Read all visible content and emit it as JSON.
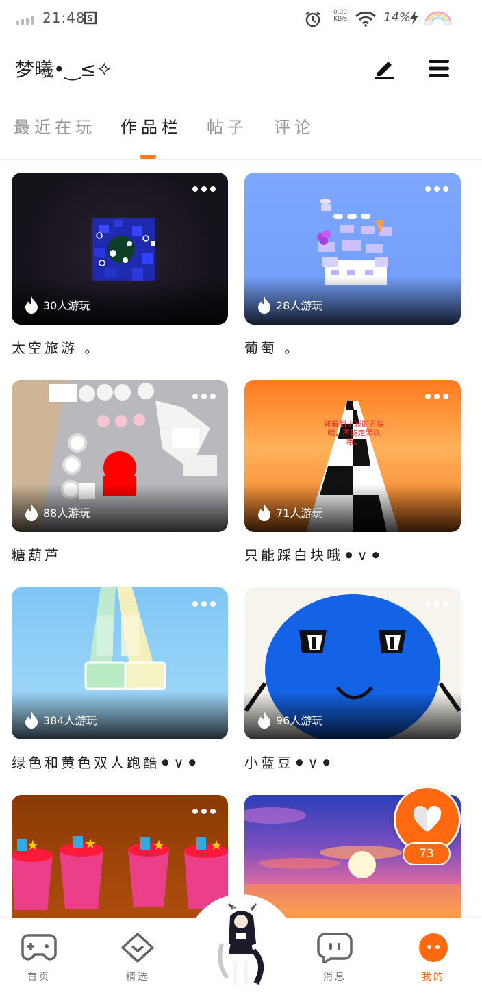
{
  "status_bar": {
    "time": "21:48",
    "net_speed_value": "0.00",
    "net_speed_unit": "KB/s",
    "battery": "14%",
    "icons": [
      "signal-icon",
      "screen-capture-icon",
      "alarm-icon",
      "wifi-icon",
      "charging-icon",
      "rainbow-icon"
    ]
  },
  "header": {
    "username": "梦曦•‿≤✧"
  },
  "tabs": [
    {
      "label": "最近在玩",
      "active": false
    },
    {
      "label": "作品栏",
      "active": true
    },
    {
      "label": "帖子",
      "active": false
    },
    {
      "label": "评论",
      "active": false
    }
  ],
  "works": [
    {
      "title": "太空旅游 。",
      "plays": "30人游玩"
    },
    {
      "title": "葡萄 。",
      "plays": "28人游玩"
    },
    {
      "title": "糖葫芦",
      "plays": "88人游玩"
    },
    {
      "title": "只能踩白块哦⚫∨⚫",
      "plays": "71人游玩"
    },
    {
      "title": "绿色和黄色双人跑酷⚫∨⚫",
      "plays": "384人游玩"
    },
    {
      "title": "小蓝豆⚫∨⚫",
      "plays": "96人游玩"
    },
    {
      "title": "",
      "plays": ""
    },
    {
      "title": "",
      "plays": ""
    }
  ],
  "piano_overlay_text": "按着到止端的方块哦，不能走黑块哦。",
  "like": {
    "count": "73"
  },
  "bottom_nav": [
    {
      "label": "首页",
      "icon": "gamepad-icon",
      "active": false
    },
    {
      "label": "精选",
      "icon": "heart-badge-icon",
      "active": false
    },
    {
      "label": "消息",
      "icon": "chat-icon",
      "active": false
    },
    {
      "label": "我的",
      "icon": "me-icon",
      "active": true
    }
  ],
  "colors": {
    "accent": "#ff6a10",
    "inactive": "#999999"
  }
}
